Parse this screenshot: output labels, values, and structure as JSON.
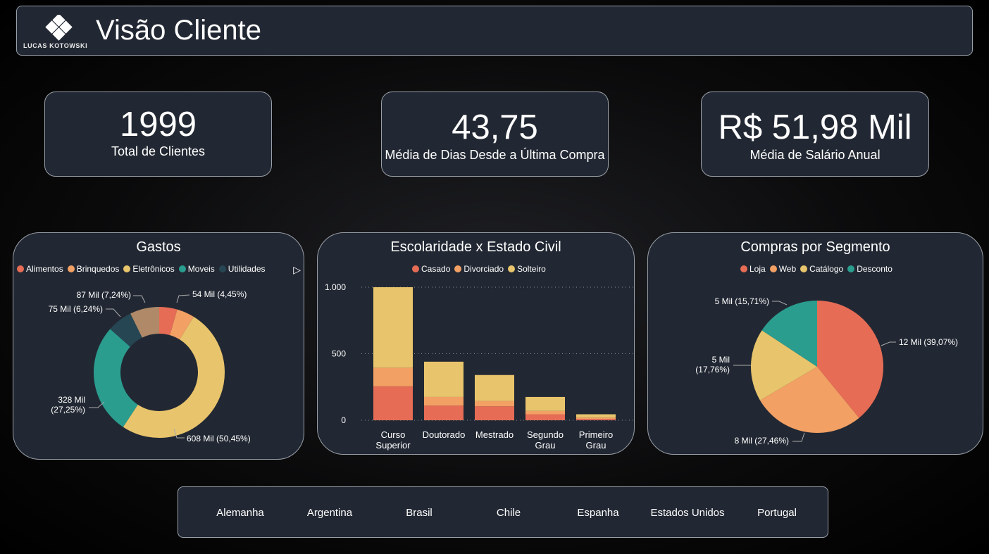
{
  "header": {
    "logo_text": "LUCAS KOTOWSKI",
    "title": "Visão Cliente"
  },
  "kpis": [
    {
      "value": "1999",
      "label": "Total de Clientes"
    },
    {
      "value": "43,75",
      "label": "Média de Dias Desde a Última Compra"
    },
    {
      "value": "R$ 51,98 Mil",
      "label": "Média de Salário Anual"
    }
  ],
  "chart_data": [
    {
      "type": "pie",
      "variant": "donut",
      "title": "Gastos",
      "legend_position": "top",
      "categories": [
        "Alimentos",
        "Brinquedos",
        "Eletrônicos",
        "Moveis",
        "Utilidades"
      ],
      "legend_labels": [
        "Alimentos",
        "Brinquedos",
        "Eletrônicos",
        "Moveis",
        "Utilidades"
      ],
      "values": [
        54,
        0,
        608,
        328,
        75
      ],
      "slices": [
        {
          "name": "Alimentos",
          "percent": 4.45,
          "label": "54 Mil (4,45%)",
          "color": "#e66c55"
        },
        {
          "name": "Brinquedos",
          "percent": 4.39,
          "label": "",
          "color": "#f2a064"
        },
        {
          "name": "Eletrônicos",
          "percent": 50.45,
          "label": "608 Mil (50,45%)",
          "color": "#e8c46c"
        },
        {
          "name": "Moveis",
          "percent": 27.25,
          "label": "328 Mil\n(27,25%)",
          "color": "#2a9d8f"
        },
        {
          "name": "Utilidades",
          "percent": 6.24,
          "label": "75 Mil (6,24%)",
          "color": "#264653"
        },
        {
          "name": "",
          "percent": 7.24,
          "label": "87 Mil (7,24%)",
          "color": "#b08968"
        }
      ]
    },
    {
      "type": "bar",
      "variant": "stacked",
      "title": "Escolaridade x Estado Civil",
      "legend_position": "top",
      "categories": [
        "Curso Superior",
        "Doutorado",
        "Mestrado",
        "Segundo Grau",
        "Primeiro Grau"
      ],
      "category_labels": [
        [
          "Curso",
          "Superior"
        ],
        [
          "Doutorado"
        ],
        [
          "Mestrado"
        ],
        [
          "Segundo",
          "Grau"
        ],
        [
          "Primeiro",
          "Grau"
        ]
      ],
      "ylim": [
        0,
        1000
      ],
      "yticks": [
        0,
        500,
        1000
      ],
      "ytick_labels": [
        "0",
        "500",
        "1.000"
      ],
      "grid": true,
      "series": [
        {
          "name": "Casado",
          "color": "#e66c55",
          "values": [
            255,
            110,
            105,
            45,
            10
          ]
        },
        {
          "name": "Divorciado",
          "color": "#f2a064",
          "values": [
            140,
            65,
            40,
            25,
            10
          ]
        },
        {
          "name": "Solteiro",
          "color": "#e8c46c",
          "values": [
            605,
            265,
            195,
            105,
            25
          ]
        }
      ]
    },
    {
      "type": "pie",
      "title": "Compras por Segmento",
      "legend_position": "top",
      "categories": [
        "Loja",
        "Web",
        "Catálogo",
        "Desconto"
      ],
      "values": [
        12,
        8,
        5,
        5
      ],
      "slices": [
        {
          "name": "Loja",
          "percent": 39.07,
          "label": "12 Mil (39,07%)",
          "color": "#e66c55"
        },
        {
          "name": "Web",
          "percent": 27.46,
          "label": "8 Mil (27,46%)",
          "color": "#f2a064"
        },
        {
          "name": "Catálogo",
          "percent": 17.76,
          "label": "5 Mil\n(17,76%)",
          "color": "#e8c46c"
        },
        {
          "name": "Desconto",
          "percent": 15.71,
          "label": "5 Mil (15,71%)",
          "color": "#2a9d8f"
        }
      ]
    }
  ],
  "countries": [
    "Alemanha",
    "Argentina",
    "Brasil",
    "Chile",
    "Espanha",
    "Estados Unidos",
    "Portugal"
  ]
}
